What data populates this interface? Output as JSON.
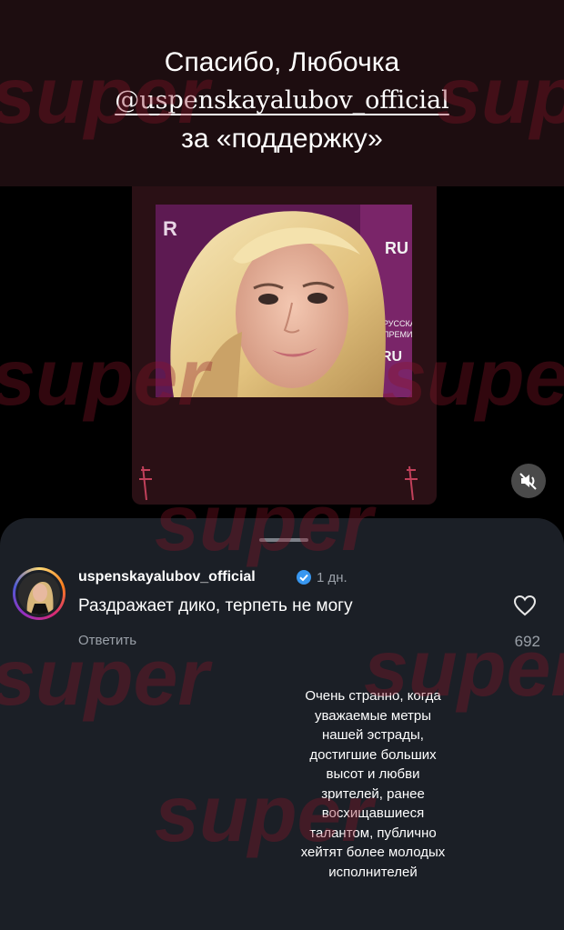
{
  "story": {
    "caption": {
      "line1": "Спасибо, Любочка",
      "mention": "@uspenskayalubov_official",
      "line3": "за «поддержку»"
    },
    "photo_badges": {
      "left_letter": "R",
      "right_top": "RU",
      "mid_line1": "РУССКА",
      "mid_line2": "ПРЕМИ",
      "bottom": "RU"
    },
    "mute_icon": "speaker-muted-icon"
  },
  "comment_sheet": {
    "username": "uspenskayalubov_official",
    "verified_icon": "verified-badge-icon",
    "time": "1 дн.",
    "text": "Раздражает дико, терпеть не могу",
    "reply_label": "Ответить",
    "like_icon": "heart-outline-icon",
    "like_count": "692"
  },
  "note_lines": [
    "Очень странно, когда",
    "уважаемые метры",
    "нашей эстрады,",
    "достигшие больших",
    "высот и любви",
    "зрителей, ранее",
    "восхищавшиеся",
    "талантом, публично",
    "хейтят более молодых",
    "исполнителей"
  ],
  "watermark": "super",
  "colors": {
    "background": "#000000",
    "top_band": "#1d0d10",
    "sheet": "#1b1f26",
    "verified": "#3897f0",
    "muted_text": "#9aa0a8",
    "watermark": "#8c1428"
  }
}
